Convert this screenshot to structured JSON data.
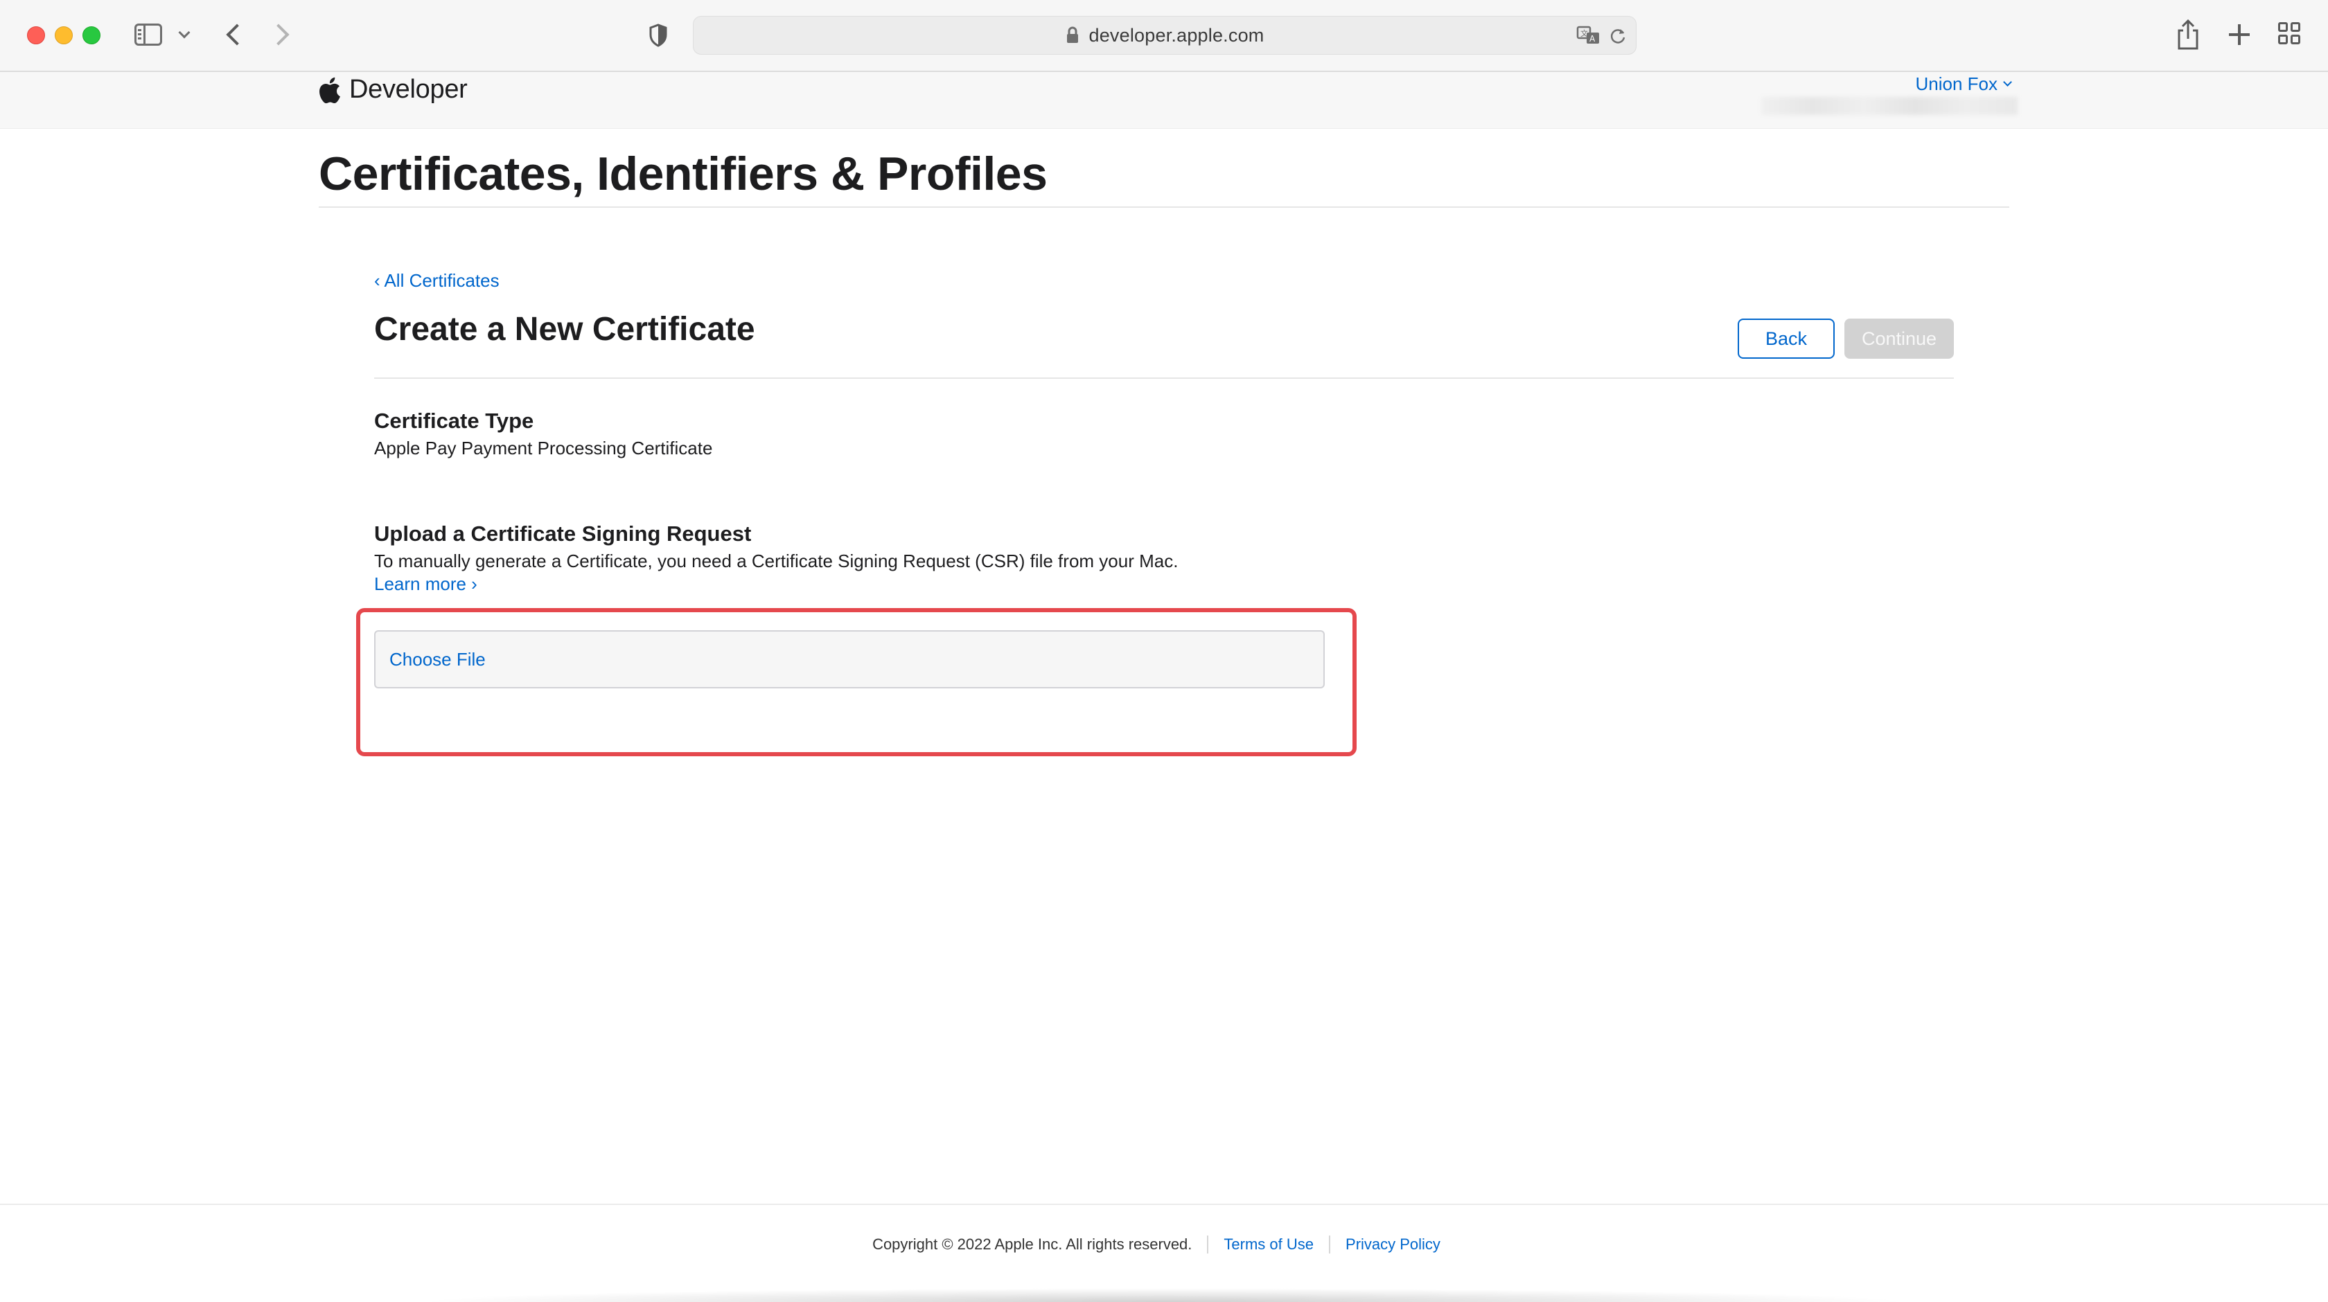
{
  "browser": {
    "url": "developer.apple.com"
  },
  "site": {
    "brand": "Developer",
    "account_name": "Union Fox"
  },
  "page": {
    "title": "Certificates, Identifiers & Profiles",
    "back_link": "‹ All Certificates",
    "section_title": "Create a New Certificate",
    "buttons": {
      "back": "Back",
      "continue": "Continue"
    }
  },
  "certificate_type": {
    "label": "Certificate Type",
    "value": "Apple Pay Payment Processing Certificate"
  },
  "upload": {
    "label": "Upload a Certificate Signing Request",
    "description": "To manually generate a Certificate, you need a Certificate Signing Request (CSR) file from your Mac.",
    "learn_more": "Learn more ›",
    "choose_file": "Choose File"
  },
  "footer": {
    "copyright": "Copyright © 2022 Apple Inc. All rights reserved.",
    "terms": "Terms of Use",
    "privacy": "Privacy Policy"
  },
  "colors": {
    "accent": "#0066cc",
    "highlight": "#e5484d",
    "disabled_button": "#d2d2d2"
  }
}
